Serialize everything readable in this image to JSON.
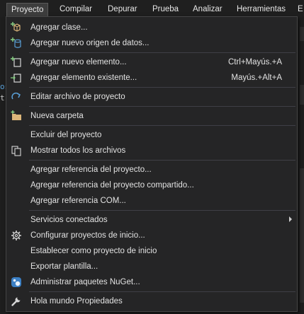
{
  "menubar": {
    "items": [
      {
        "label": "Proyecto",
        "active": true
      },
      {
        "label": "Compilar"
      },
      {
        "label": "Depurar"
      },
      {
        "label": "Prueba"
      },
      {
        "label": "Analizar"
      },
      {
        "label": "Herramientas"
      },
      {
        "label": "E"
      }
    ]
  },
  "background_fragments": [
    "os",
    "t"
  ],
  "menu": {
    "items": [
      {
        "label": "Agregar clase...",
        "icon": "add-class-icon"
      },
      {
        "label": "Agregar nuevo origen de datos...",
        "icon": "add-data-source-icon"
      },
      {
        "label": "Agregar nuevo elemento...",
        "shortcut": "Ctrl+Mayús.+A",
        "icon": "new-item-icon"
      },
      {
        "label": "Agregar elemento existente...",
        "shortcut": "Mayús.+Alt+A",
        "icon": "existing-item-icon"
      },
      {
        "label": "Editar archivo de proyecto",
        "icon": "edit-project-file-icon"
      },
      {
        "label": "Nueva carpeta",
        "icon": "new-folder-icon"
      },
      {
        "label": "Excluir del proyecto"
      },
      {
        "label": "Mostrar todos los archivos",
        "icon": "show-all-files-icon"
      },
      {
        "label": "Agregar referencia del proyecto..."
      },
      {
        "label": "Agregar referencia del proyecto compartido..."
      },
      {
        "label": "Agregar referencia COM..."
      },
      {
        "label": "Servicios conectados",
        "submenu": true
      },
      {
        "label": "Configurar proyectos de inicio...",
        "icon": "gear-icon"
      },
      {
        "label": "Establecer como proyecto de inicio"
      },
      {
        "label": "Exportar plantilla..."
      },
      {
        "label": "Administrar paquetes NuGet...",
        "icon": "nuget-icon"
      },
      {
        "label": "Hola mundo Propiedades",
        "icon": "wrench-icon"
      }
    ]
  },
  "colors": {
    "menu_bg": "#252526",
    "menubar_bg": "#1f1f1f",
    "border": "#454545",
    "separator": "#3f3f46",
    "text": "#e2e2e2",
    "accent_blue": "#5aa0d8",
    "folder": "#dcb67a"
  }
}
